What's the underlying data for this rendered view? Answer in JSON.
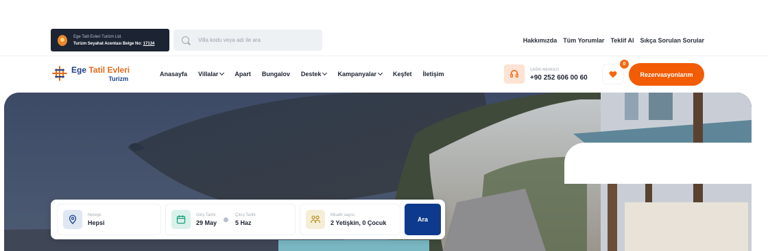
{
  "license": {
    "line1": "Ege Tatil Evleri Turizm Ltd.",
    "line2_prefix": "Turizm Seyahat Acentası Belge No:",
    "license_no": "17134"
  },
  "search": {
    "placeholder": "Villa kodu veya adı ile ara"
  },
  "top_links": [
    "Hakkımızda",
    "Tüm Yorumlar",
    "Teklif Al",
    "Sıkça Sorulan Sorular"
  ],
  "logo": {
    "name_part1": "Ege ",
    "name_part2": "Tatil Evleri",
    "sub": "Turizm"
  },
  "nav": {
    "home": "Anasayfa",
    "villas": "Villalar",
    "apart": "Apart",
    "bungalow": "Bungalov",
    "support": "Destek",
    "campaigns": "Kampanyalar",
    "explore": "Keşfet",
    "contact": "İletişim"
  },
  "call_center": {
    "label": "ÇAĞRI MERKEZİ",
    "phone": "+90 252 606 00 60"
  },
  "favorites": {
    "count": "0"
  },
  "reservations_button": "Rezervasyonlarım",
  "booking": {
    "destination": {
      "label": "Nereye",
      "value": "Hepsi"
    },
    "checkin": {
      "label": "Giriş Tarihi",
      "value": "29 May"
    },
    "checkout": {
      "label": "Çıkış Tarihi",
      "value": "5 Haz"
    },
    "guests": {
      "label": "Misafir sayısı",
      "value": "2 Yetişkin, 0 Çocuk"
    },
    "search_button": "Ara"
  },
  "colors": {
    "brand_orange": "#f25c05",
    "brand_blue": "#1f3f8a",
    "search_button": "#0d3a8c",
    "license_bg": "#1c2433"
  },
  "icons": {
    "search": "search-icon",
    "phone": "headset-icon",
    "favorite": "heart-icon",
    "location": "location-pin-icon",
    "calendar": "calendar-icon",
    "guests": "guests-icon"
  }
}
